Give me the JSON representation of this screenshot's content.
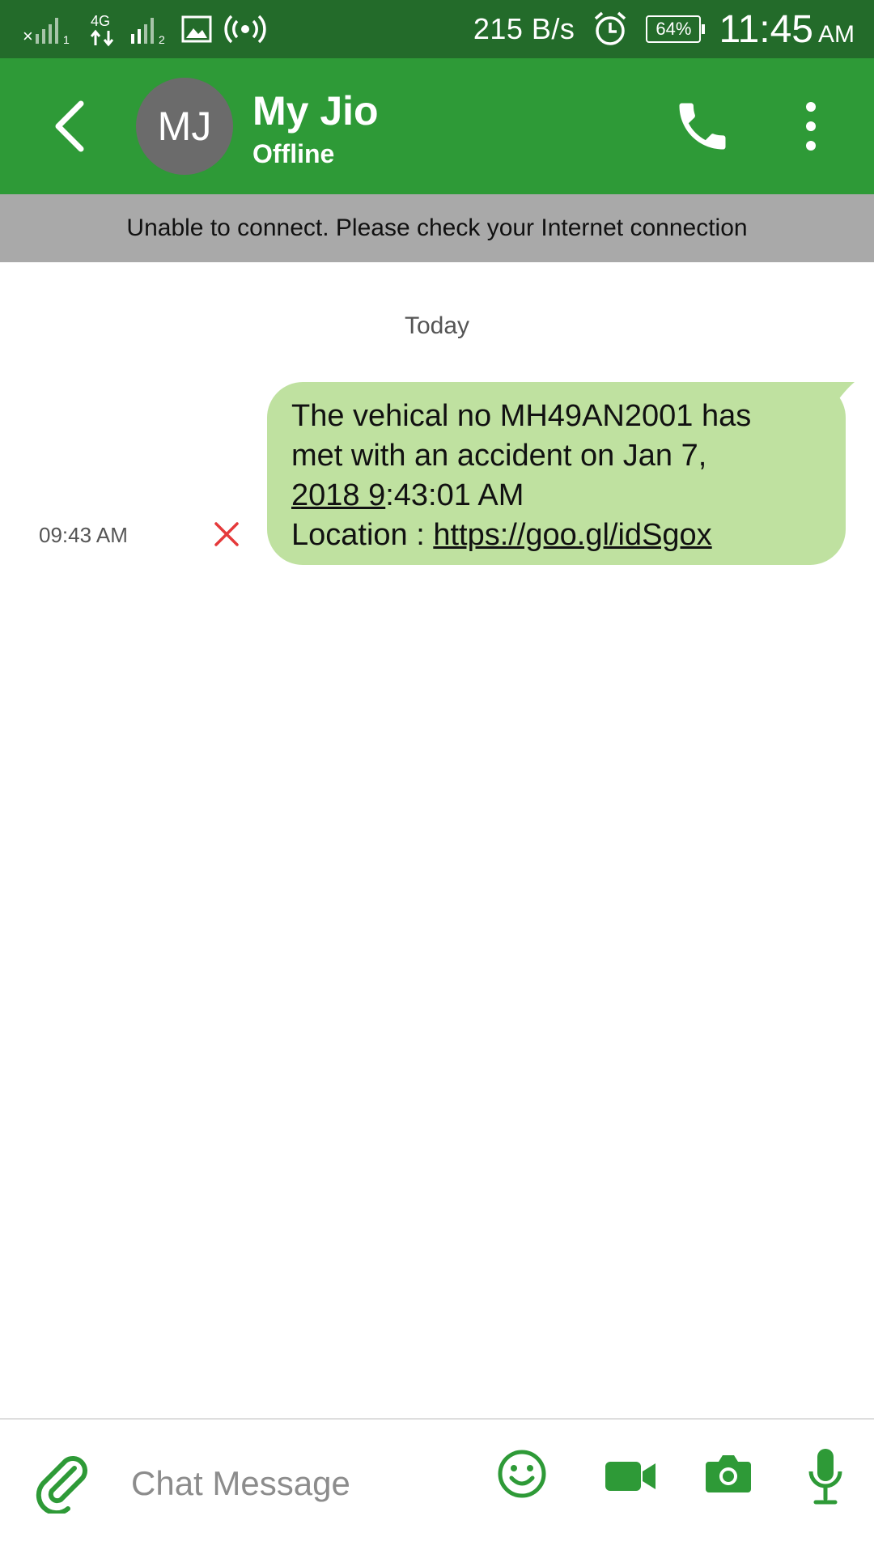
{
  "status_bar": {
    "net_speed": "215 B/s",
    "battery": "64%",
    "time": "11:45",
    "ampm": "AM"
  },
  "header": {
    "avatar_initials": "MJ",
    "contact_name": "My Jio",
    "contact_status": "Offline"
  },
  "banner": {
    "text": "Unable to connect. Please check your Internet connection"
  },
  "conversation": {
    "date_separator": "Today",
    "message": {
      "line1": "The vehical no MH49AN2001 has",
      "line2": "met with an accident on Jan 7,",
      "line3_link": "2018 9",
      "line3_rest": ":43:01 AM",
      "line4_prefix": "Location : ",
      "line4_link": "https://goo.gl/idSgox",
      "time": "09:43 AM",
      "status": "failed"
    }
  },
  "composer": {
    "placeholder": "Chat Message"
  },
  "colors": {
    "status_bar": "#236b2a",
    "app_bar": "#2e9a37",
    "bubble": "#bfe1a0",
    "banner": "#a9a9a9",
    "fail": "#e5393a",
    "icon_green": "#2e9a37"
  }
}
